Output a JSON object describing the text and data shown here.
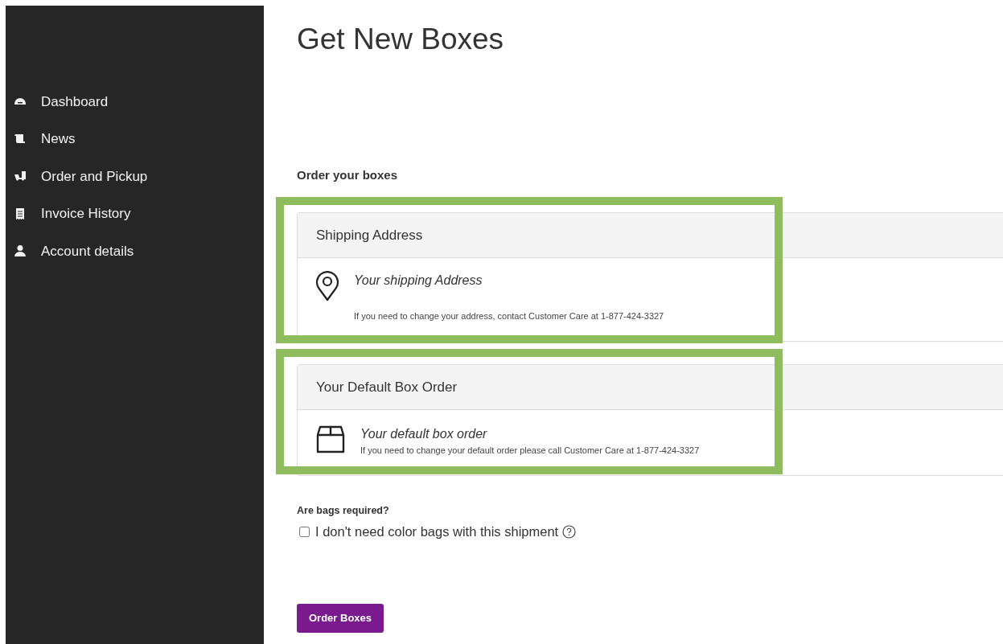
{
  "sidebar": {
    "items": [
      {
        "label": "Dashboard",
        "kind": "dashboard"
      },
      {
        "label": "News",
        "kind": "news"
      },
      {
        "label": "Order and Pickup",
        "kind": "order"
      },
      {
        "label": "Invoice History",
        "kind": "invoice"
      },
      {
        "label": "Account details",
        "kind": "account"
      }
    ]
  },
  "page_title": "Get New Boxes",
  "section_label": "Order your boxes",
  "cards": [
    {
      "kind": "address",
      "header": "Shipping Address",
      "value": "Your shipping Address",
      "note": "If you need to change your address, contact Customer Care at 1-877-424-3327",
      "highlighted": true
    },
    {
      "kind": "box",
      "header": "Your Default Box Order",
      "value": "Your default box order",
      "note": "If you need to change your default order please call Customer Care at 1-877-424-3327",
      "highlighted": true
    }
  ],
  "bags": {
    "question": "Are bags required?",
    "checkbox_label": "I don't need color bags with this shipment",
    "checked": false
  },
  "submit_button": "Order Boxes"
}
